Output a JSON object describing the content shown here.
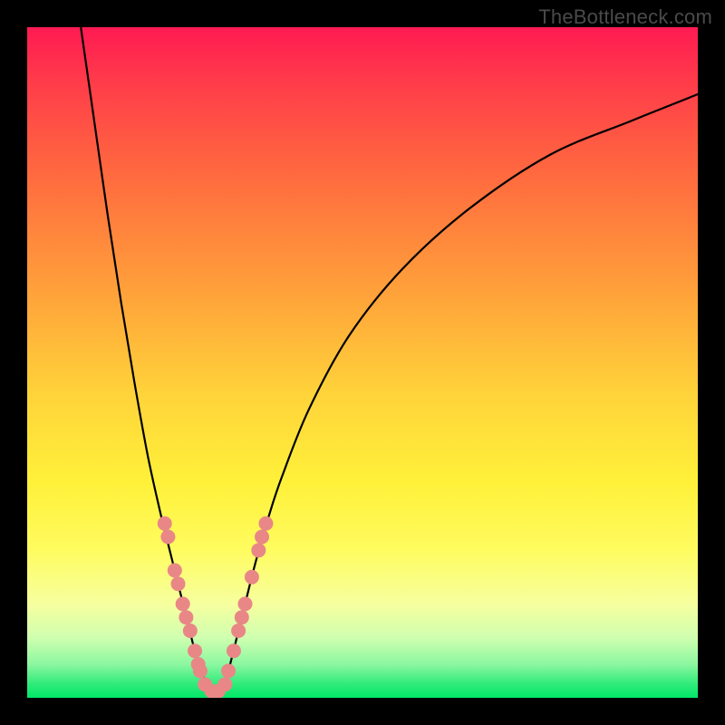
{
  "watermark": "TheBottleneck.com",
  "chart_data": {
    "type": "line",
    "title": "",
    "xlabel": "",
    "ylabel": "",
    "xlim": [
      0,
      100
    ],
    "ylim": [
      0,
      100
    ],
    "background_gradient": {
      "stops": [
        {
          "pos": 0,
          "color": "#ff1a52"
        },
        {
          "pos": 8,
          "color": "#ff3b4a"
        },
        {
          "pos": 22,
          "color": "#ff6a3f"
        },
        {
          "pos": 40,
          "color": "#ffa33a"
        },
        {
          "pos": 55,
          "color": "#ffd43a"
        },
        {
          "pos": 68,
          "color": "#fff13a"
        },
        {
          "pos": 78,
          "color": "#fffc60"
        },
        {
          "pos": 86,
          "color": "#f6ff9e"
        },
        {
          "pos": 91,
          "color": "#d0ffb0"
        },
        {
          "pos": 95,
          "color": "#8cf7a0"
        },
        {
          "pos": 98,
          "color": "#2eea7a"
        },
        {
          "pos": 100,
          "color": "#00e768"
        }
      ]
    },
    "series": [
      {
        "name": "left-branch",
        "color": "#000000",
        "x": [
          8,
          10,
          12,
          14,
          16,
          18,
          20,
          21,
          22,
          23,
          24,
          25,
          26,
          27
        ],
        "y": [
          100,
          86,
          72,
          59,
          47,
          36,
          27,
          23,
          19,
          15,
          11,
          7,
          4,
          1
        ]
      },
      {
        "name": "right-branch",
        "color": "#000000",
        "x": [
          29,
          30,
          32,
          34,
          36,
          38,
          42,
          48,
          56,
          66,
          78,
          90,
          100
        ],
        "y": [
          1,
          4,
          12,
          20,
          27,
          33,
          43,
          54,
          64,
          73,
          81,
          86,
          90
        ]
      }
    ],
    "scatter": {
      "name": "highlight-points",
      "color": "#e98787",
      "radius_px": 8,
      "points": [
        {
          "x": 20.5,
          "y": 26
        },
        {
          "x": 21.0,
          "y": 24
        },
        {
          "x": 22.0,
          "y": 19
        },
        {
          "x": 22.5,
          "y": 17
        },
        {
          "x": 23.2,
          "y": 14
        },
        {
          "x": 23.7,
          "y": 12
        },
        {
          "x": 24.3,
          "y": 10
        },
        {
          "x": 25.0,
          "y": 7
        },
        {
          "x": 25.5,
          "y": 5
        },
        {
          "x": 25.8,
          "y": 4
        },
        {
          "x": 26.5,
          "y": 2
        },
        {
          "x": 27.5,
          "y": 1
        },
        {
          "x": 28.5,
          "y": 1
        },
        {
          "x": 29.5,
          "y": 2
        },
        {
          "x": 30.0,
          "y": 4
        },
        {
          "x": 30.8,
          "y": 7
        },
        {
          "x": 31.5,
          "y": 10
        },
        {
          "x": 32.0,
          "y": 12
        },
        {
          "x": 32.5,
          "y": 14
        },
        {
          "x": 33.5,
          "y": 18
        },
        {
          "x": 34.5,
          "y": 22
        },
        {
          "x": 35.0,
          "y": 24
        },
        {
          "x": 35.6,
          "y": 26
        }
      ]
    }
  }
}
